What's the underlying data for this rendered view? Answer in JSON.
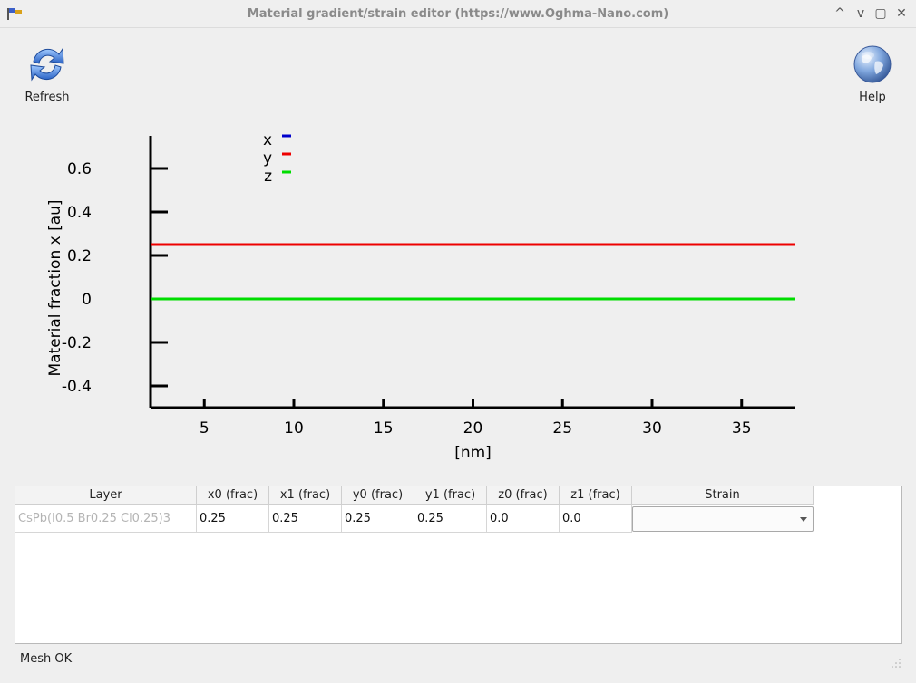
{
  "window": {
    "title": "Material gradient/strain editor (https://www.Oghma-Nano.com)",
    "controls": [
      "^",
      "v",
      "▢",
      "✕"
    ]
  },
  "toolbar": {
    "refresh_label": "Refresh",
    "help_label": "Help"
  },
  "chart_data": {
    "type": "line",
    "ylabel": "Material fraction x [au]",
    "xlabel": "[nm]",
    "xlim": [
      2,
      38
    ],
    "ylim": [
      -0.5,
      0.75
    ],
    "xticks": [
      5,
      10,
      15,
      20,
      25,
      30,
      35
    ],
    "yticks": [
      0.6,
      0.4,
      0.2,
      0,
      -0.2,
      -0.4
    ],
    "legend_position": "top-left",
    "series": [
      {
        "name": "x",
        "color": "#0000cc",
        "x": [
          2,
          38
        ],
        "y": [
          0.25,
          0.25
        ]
      },
      {
        "name": "y",
        "color": "#ee0000",
        "x": [
          2,
          38
        ],
        "y": [
          0.25,
          0.25
        ]
      },
      {
        "name": "z",
        "color": "#00dd00",
        "x": [
          2,
          38
        ],
        "y": [
          0.0,
          0.0
        ]
      }
    ]
  },
  "table": {
    "headers": [
      "Layer",
      "x0 (frac)",
      "x1 (frac)",
      "y0 (frac)",
      "y1 (frac)",
      "z0 (frac)",
      "z1 (frac)",
      "Strain"
    ],
    "rows": [
      {
        "layer": "CsPb(I0.5 Br0.25 Cl0.25)3",
        "x0": "0.25",
        "x1": "0.25",
        "y0": "0.25",
        "y1": "0.25",
        "z0": "0.0",
        "z1": "0.0",
        "strain": ""
      }
    ]
  },
  "status": {
    "text": "Mesh OK"
  }
}
